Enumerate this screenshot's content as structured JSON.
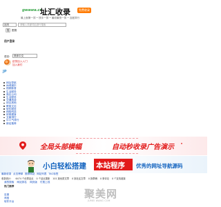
{
  "header": {
    "logo_text": "gwawa.cn",
    "title": "址汇收录",
    "badge": "免费收录",
    "tagline": "最上面第一排 • 快手一排 • 最收最快一排 • 百度排行"
  },
  "search": {
    "type_option": "站内",
    "placeholder": "请输入关键词后进行搜索",
    "button": "搜",
    "button_label": "图搜"
  },
  "login": {
    "title": "用户登录"
  },
  "language": {
    "label": "语言:",
    "selected": "简体中文"
  },
  "join": {
    "line1": "赶快加入入门",
    "line2": "加入我们"
  },
  "small_logo": "JP",
  "nav": {
    "items": [
      "网址导航",
      "休闲娱乐",
      "视频影音",
      "生活服务",
      "商业公司",
      "生活服务",
      "交通旅游",
      "综合其他",
      "教育文化",
      "软件服务",
      "网络科技",
      "体育健身",
      "文章排行",
      "中人气排行",
      "新站推荐"
    ]
  },
  "banner1": {
    "text1": "全局头部横幅",
    "text2": "自动秒收录广告演示"
  },
  "banner2": {
    "text1": "小白轻松搭建",
    "highlight": "本站程序",
    "text2": "优秀的网址导航源码"
  },
  "links_row": [
    "最新收录",
    "点击榜单",
    "推荐网站",
    "网站列表",
    "TAG标签"
  ],
  "stats": {
    "items": [
      "收录统计：",
      "6474 个优秀站点",
      "0 个站点更新",
      "101 篇优质文章",
      "0 篇社区文章",
      "0 篇草稿",
      "0 条评论",
      "0 个友情链接"
    ]
  },
  "row3": [
    "我的搜索",
    "网站排名",
    "网页版",
    "付费上线"
  ],
  "hot": {
    "title": "热门推荐",
    "items": [
      "百度",
      "淘宝",
      "软件平台"
    ]
  },
  "watermark": {
    "text": "聚美网",
    "sub": "JUMEI WANG COM"
  },
  "colors": {
    "logo_green": "#3aa64a",
    "badge_orange": "#ff7a00",
    "link_blue": "#1a55c4",
    "banner_red": "#e21a1a",
    "banner_blue": "#1565c0"
  }
}
